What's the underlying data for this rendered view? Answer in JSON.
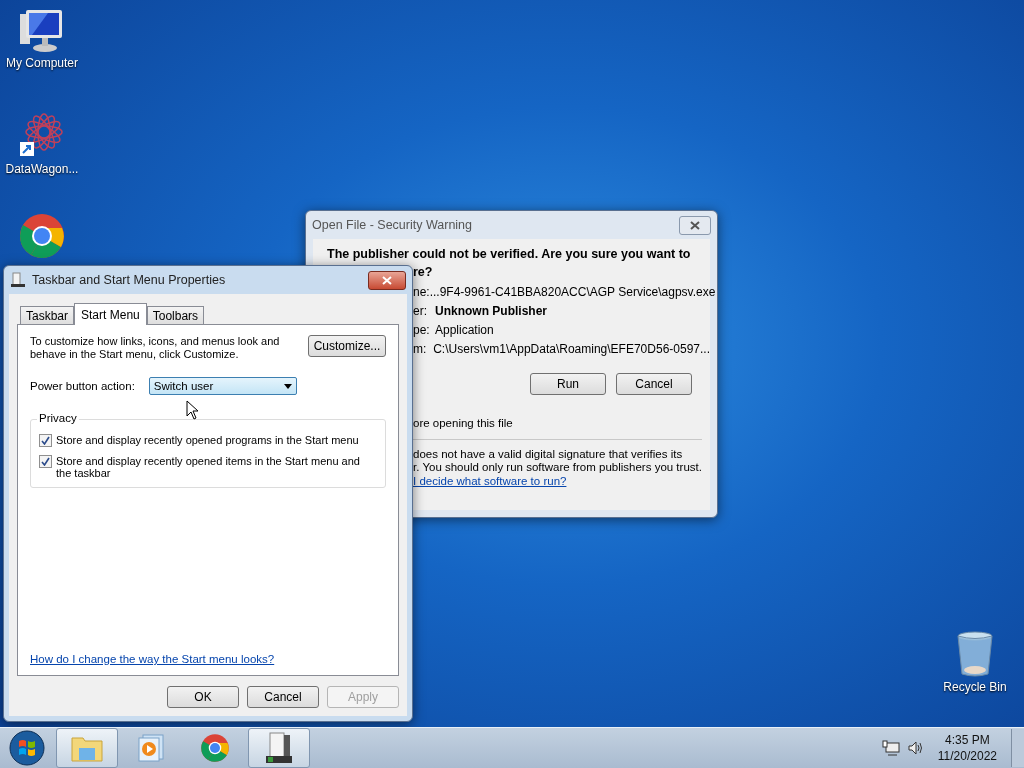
{
  "desktop_icons": [
    {
      "kind": "computer",
      "label": "My Computer"
    },
    {
      "kind": "shortcut",
      "label": "DataWagon..."
    },
    {
      "kind": "chrome"
    },
    {
      "kind": "recycle",
      "label": "Recycle Bin"
    }
  ],
  "security_dialog": {
    "title": "Open File - Security Warning",
    "heading_line1": "The publisher could not be verified.  Are you sure you want to",
    "heading_line2": "re?",
    "fields": [
      {
        "label": "ne:",
        "value": "...9F4-9961-C41BBA820ACC\\AGP Service\\agpsv.exe",
        "bold": false
      },
      {
        "label": "er:",
        "value": "Unknown Publisher",
        "bold": true
      },
      {
        "label": "pe:",
        "value": "Application",
        "bold": false
      },
      {
        "label": "m:",
        "value": "C:\\Users\\vm1\\AppData\\Roaming\\EFE70D56-0597...",
        "bold": false
      }
    ],
    "buttons": [
      "Run",
      "Cancel"
    ],
    "checkbox_text": "ore opening this file",
    "message_lines": [
      "does not have a valid digital signature that verifies its",
      "r.  You should only run software from publishers you trust."
    ],
    "link": "I decide what software to run?"
  },
  "properties_dialog": {
    "title": "Taskbar and Start Menu Properties",
    "tabs": [
      {
        "label": "Taskbar",
        "selected": false
      },
      {
        "label": "Start Menu",
        "selected": true
      },
      {
        "label": "Toolbars",
        "selected": false
      }
    ],
    "description": "To customize how links, icons, and menus look and behave in the Start menu, click Customize.",
    "customize_button": "Customize...",
    "power_label": "Power button action:",
    "power_value": "Switch user",
    "privacy_title": "Privacy",
    "options": [
      {
        "label": "Store and display recently opened programs in the Start menu",
        "checked": true
      },
      {
        "label": "Store and display recently opened items in the Start menu and the taskbar",
        "checked": true
      }
    ],
    "help_link": "How do I change the way the Start menu looks?",
    "buttons": [
      {
        "label": "OK",
        "disabled": false
      },
      {
        "label": "Cancel",
        "disabled": false
      },
      {
        "label": "Apply",
        "disabled": true
      }
    ]
  },
  "taskbar": {
    "items": [
      {
        "kind": "explorer",
        "active": true
      },
      {
        "kind": "media",
        "active": false
      },
      {
        "kind": "chrome",
        "active": false
      },
      {
        "kind": "properties",
        "active": true
      }
    ],
    "time": "4:35 PM",
    "date": "11/20/2022"
  }
}
